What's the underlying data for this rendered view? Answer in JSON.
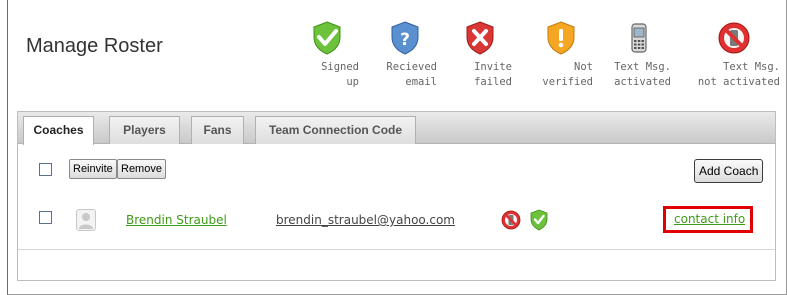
{
  "page": {
    "title": "Manage Roster"
  },
  "legend": [
    {
      "icon": "green-shield-check-icon",
      "line1": "Signed",
      "line2": "up"
    },
    {
      "icon": "blue-shield-question-icon",
      "line1": "Recieved",
      "line2": "email"
    },
    {
      "icon": "red-shield-x-icon",
      "line1": "Invite",
      "line2": "failed"
    },
    {
      "icon": "orange-shield-exclamation-icon",
      "line1": "Not",
      "line2": "verified"
    },
    {
      "icon": "mobile-phone-icon",
      "line1": "Text Msg.",
      "line2": "activated"
    },
    {
      "icon": "no-phone-icon",
      "line1": "Text Msg.",
      "line2": "not activated"
    }
  ],
  "tabs": [
    {
      "label": "Coaches",
      "active": true
    },
    {
      "label": "Players",
      "active": false
    },
    {
      "label": "Fans",
      "active": false
    },
    {
      "label": "Team Connection Code",
      "active": false
    }
  ],
  "toolbar": {
    "reinvite_label": "Reinvite",
    "remove_label": "Remove",
    "add_label": "Add Coach"
  },
  "rows": [
    {
      "name": "Brendin Straubel",
      "email": "brendin_straubel@yahoo.com",
      "status_icons": [
        "no-phone-icon",
        "green-shield-check-icon"
      ],
      "contact_label": "contact info"
    }
  ],
  "colors": {
    "link_green": "#3e9b18",
    "highlight_red": "#e00000"
  }
}
